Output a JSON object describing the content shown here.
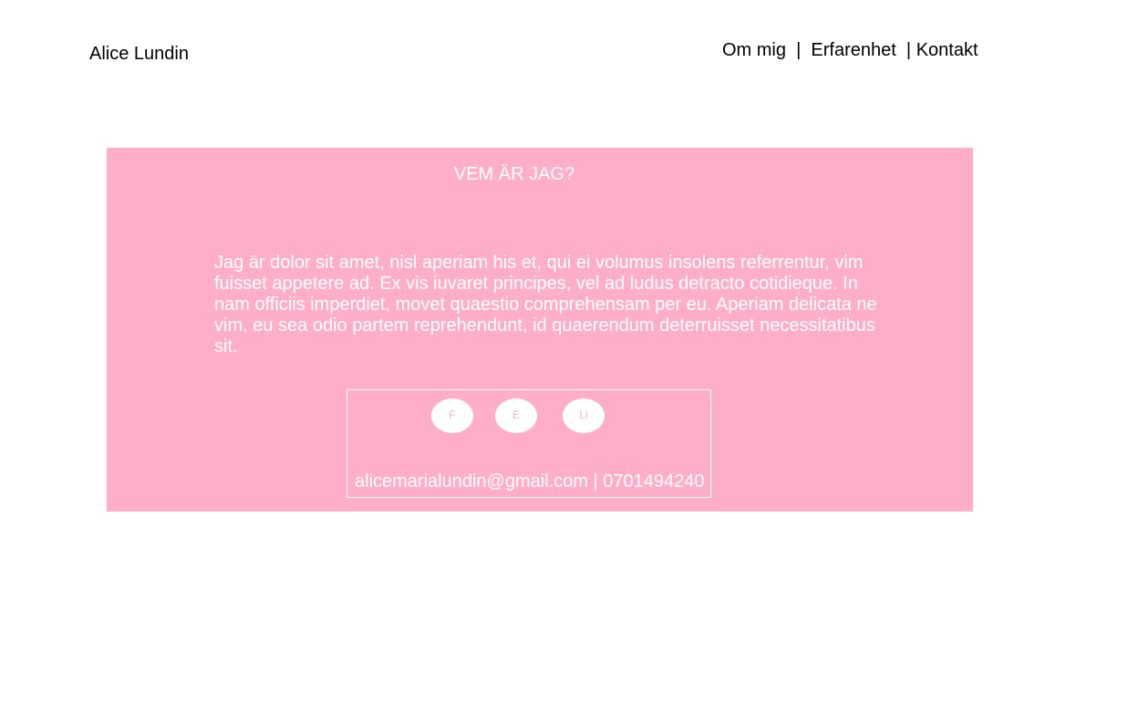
{
  "header": {
    "brand": "Alice Lundin",
    "nav": {
      "om_mig": "Om mig",
      "sep1": "  |  ",
      "erfarenhet": "Erfarenhet",
      "sep2": "  | ",
      "kontakt": "Kontakt"
    }
  },
  "about": {
    "title": "VEM ÄR JAG?",
    "text": "Jag är  dolor sit amet, nisl aperiam his et, qui ei volumus insolens referrentur, vim fuisset appetere ad. Ex vis iuvaret principes, vel ad ludus detracto cotidieque. In nam officiis imperdiet, movet quaestio comprehensam per eu. Aperiam delicata ne vim, eu sea odio partem reprehendunt, id quaerendum deterruisset necessitatibus sit."
  },
  "contact": {
    "social": {
      "facebook": "F",
      "email": "E",
      "linkedin": "Li"
    },
    "email": "alicemarialundin@gmail.com",
    "separator": " | ",
    "phone": "0701494240"
  },
  "colors": {
    "panel_bg": "#feaec9",
    "panel_text": "#ffffff",
    "header_text": "#000000"
  }
}
